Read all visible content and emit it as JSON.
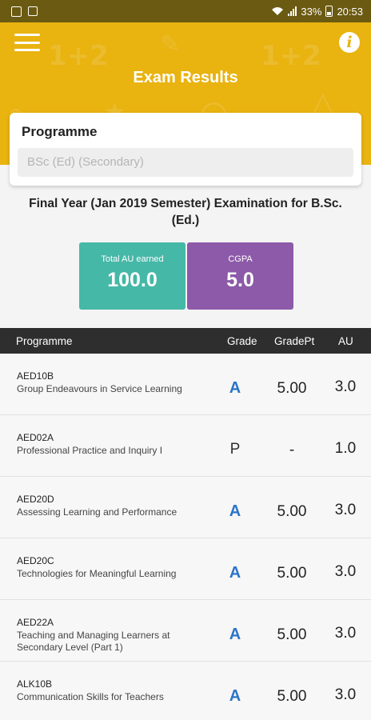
{
  "status_bar": {
    "battery": "33%",
    "time": "20:53"
  },
  "header": {
    "title": "Exam Results"
  },
  "programme": {
    "label": "Programme",
    "value": "BSc (Ed) (Secondary)"
  },
  "exam_title": "Final Year (Jan 2019 Semester) Examination for B.Sc. (Ed.)",
  "stats": {
    "total_au_label": "Total AU earned",
    "total_au_value": "100.0",
    "cgpa_label": "CGPA",
    "cgpa_value": "5.0"
  },
  "table": {
    "headers": {
      "programme": "Programme",
      "grade": "Grade",
      "gradept": "GradePt",
      "au": "AU"
    },
    "rows": [
      {
        "code": "AED10B",
        "name": "Group Endeavours in Service Learning",
        "grade": "A",
        "gradept": "5.00",
        "au": "3.0"
      },
      {
        "code": "AED02A",
        "name": "Professional Practice and Inquiry I",
        "grade": "P",
        "gradept": "-",
        "au": "1.0"
      },
      {
        "code": "AED20D",
        "name": "Assessing Learning and Performance",
        "grade": "A",
        "gradept": "5.00",
        "au": "3.0"
      },
      {
        "code": "AED20C",
        "name": "Technologies for Meaningful Learning",
        "grade": "A",
        "gradept": "5.00",
        "au": "3.0"
      },
      {
        "code": "AED22A",
        "name": "Teaching and Managing Learners at Secondary Level (Part 1)",
        "grade": "A",
        "gradept": "5.00",
        "au": "3.0"
      },
      {
        "code": "ALK10B",
        "name": "Communication Skills for Teachers",
        "grade": "A",
        "gradept": "5.00",
        "au": "3.0"
      }
    ]
  },
  "colors": {
    "header": "#e9b310",
    "status_bar": "#6b5a12",
    "au_tile": "#46b8a8",
    "cgpa_tile": "#8c5aa8",
    "grade_a": "#2b74c6",
    "table_header": "#2e2e2e"
  },
  "icons": [
    "image-icon",
    "notification-icon",
    "wifi-icon",
    "signal-icon",
    "battery-icon",
    "menu-icon",
    "info-icon"
  ]
}
